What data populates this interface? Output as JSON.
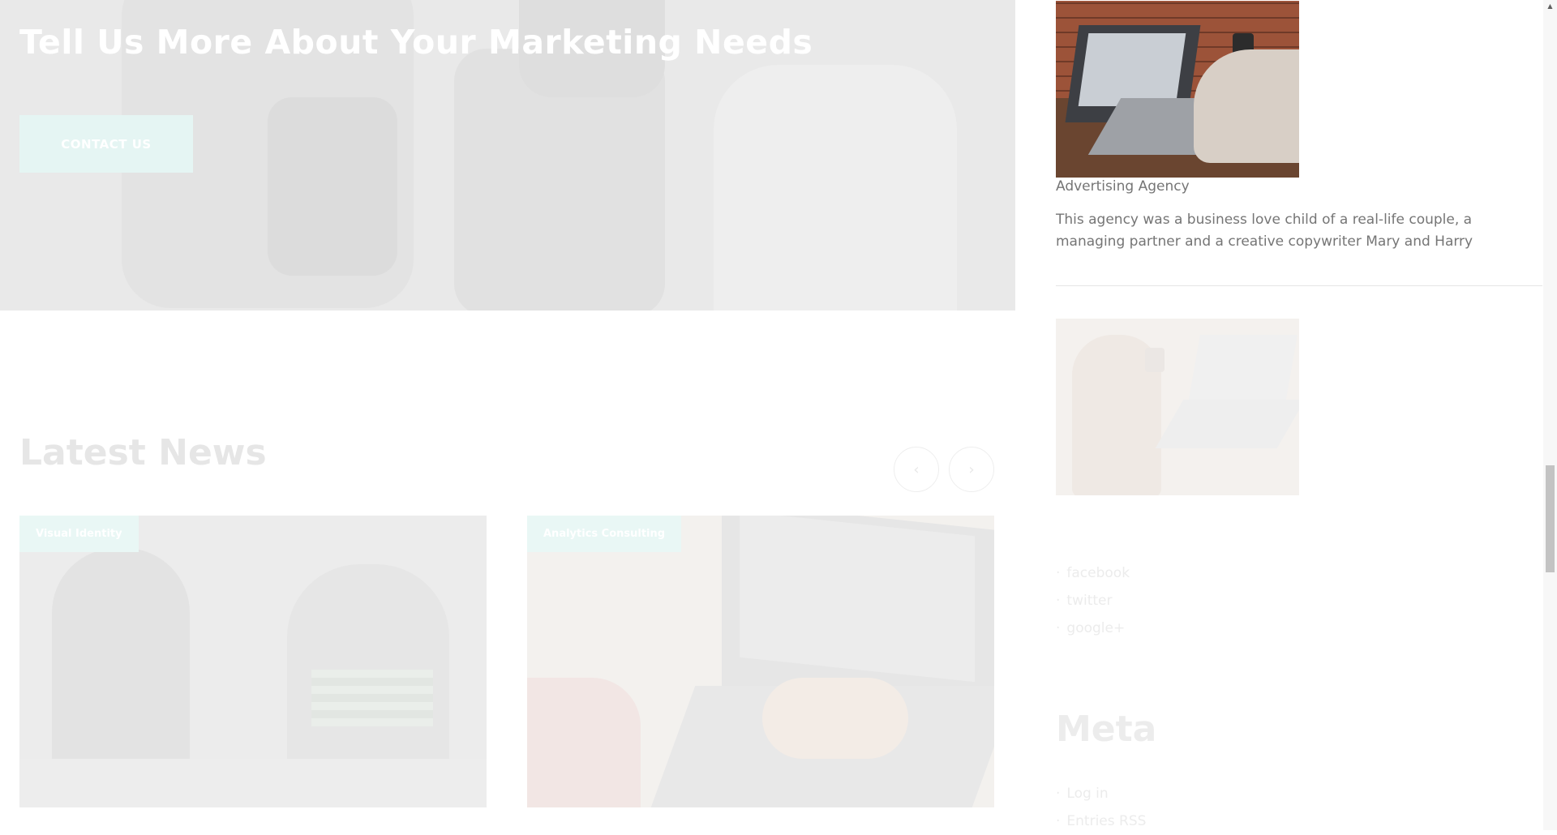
{
  "hero": {
    "title": "Tell Us More About Your Marketing Needs",
    "button_label": "CONTACT US"
  },
  "news": {
    "heading": "Latest News",
    "prev_icon": "chevron-left-icon",
    "next_icon": "chevron-right-icon",
    "prev_glyph": "‹",
    "next_glyph": "›",
    "cards": [
      {
        "category": "Visual Identity"
      },
      {
        "category": "Analytics Consulting"
      }
    ]
  },
  "sidebar": {
    "post_title": "Advertising Agency",
    "post_description": "This agency was a business love child of a real-life couple, a managing partner and a creative copywriter Mary and Harry",
    "social_links": [
      "facebook",
      "twitter",
      "google+"
    ],
    "meta_heading": "Meta",
    "meta_links": [
      "Log in",
      "Entries RSS"
    ]
  },
  "colors": {
    "accent_teal_light": "#e5f5f3",
    "text_gray": "#757575"
  }
}
